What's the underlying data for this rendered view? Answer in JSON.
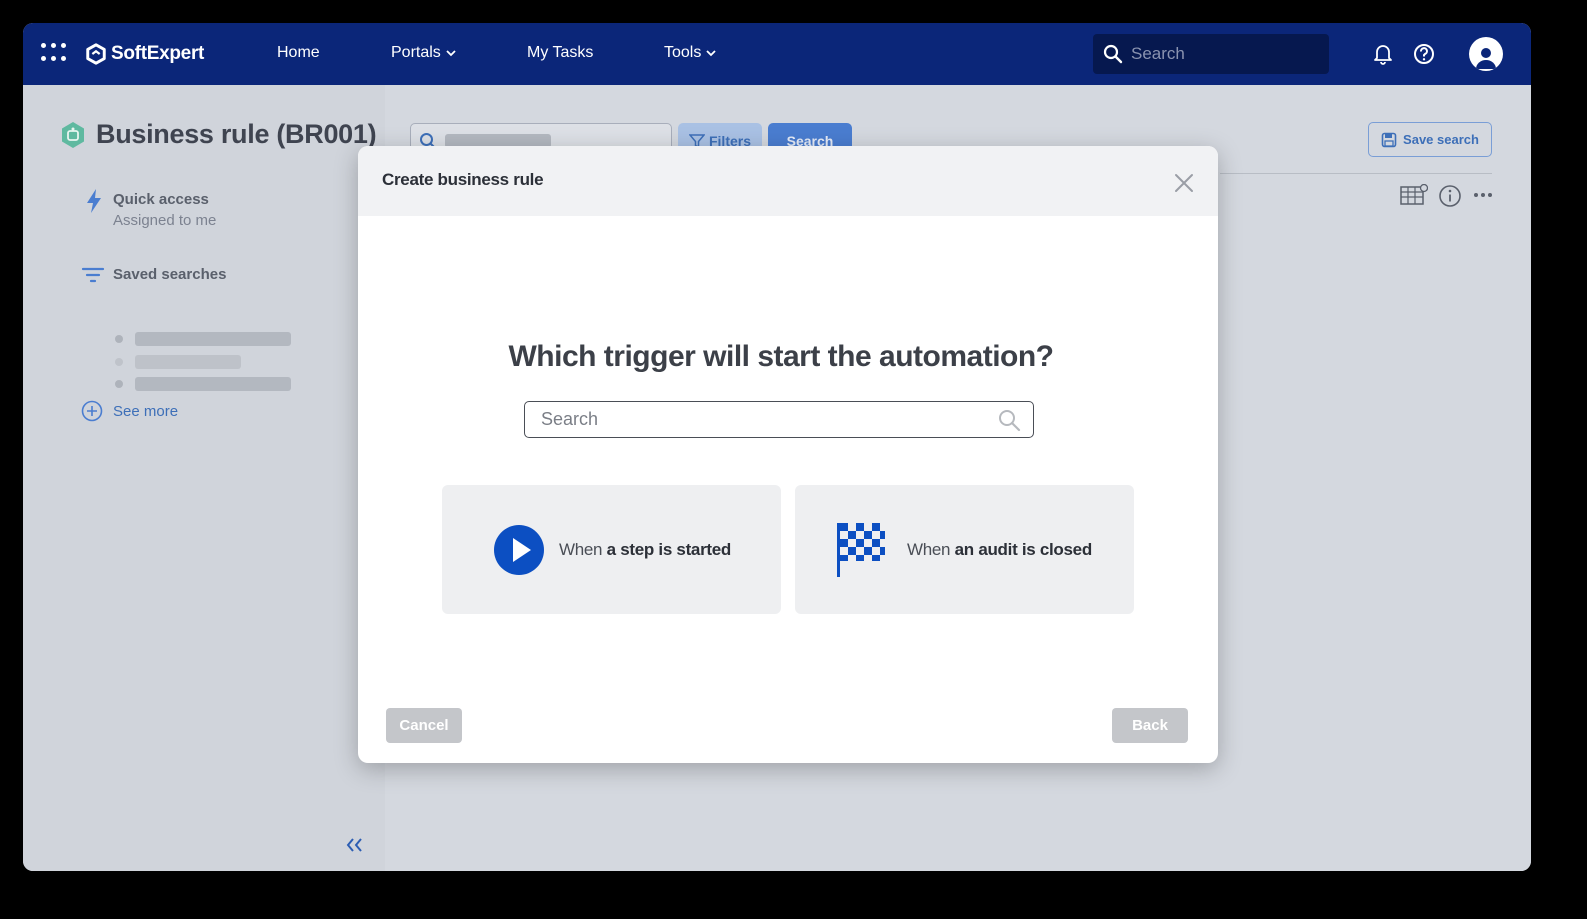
{
  "app": {
    "brand": "SoftExpert"
  },
  "nav": {
    "items": [
      {
        "label": "Home"
      },
      {
        "label": "Portals"
      },
      {
        "label": "My Tasks"
      },
      {
        "label": "Tools"
      }
    ],
    "search_placeholder": "Search"
  },
  "sidebar": {
    "title": "Business rule (BR001)",
    "quick_access": {
      "label": "Quick access",
      "sub": "Assigned to me"
    },
    "saved_searches": "Saved searches",
    "see_more": "See more"
  },
  "main": {
    "filters_label": "Filters",
    "search_button": "Search",
    "save_search": "Save search"
  },
  "modal": {
    "title": "Create business rule",
    "question": "Which trigger will start the automation?",
    "search_placeholder": "Search",
    "options": [
      {
        "prefix": "When",
        "bold": "a step is started",
        "icon": "play-icon"
      },
      {
        "prefix": "When",
        "bold": "an audit is closed",
        "icon": "checkered-flag-icon"
      }
    ],
    "cancel": "Cancel",
    "back": "Back"
  },
  "colors": {
    "topbar": "#0b2679",
    "accent": "#0c4fc2"
  }
}
